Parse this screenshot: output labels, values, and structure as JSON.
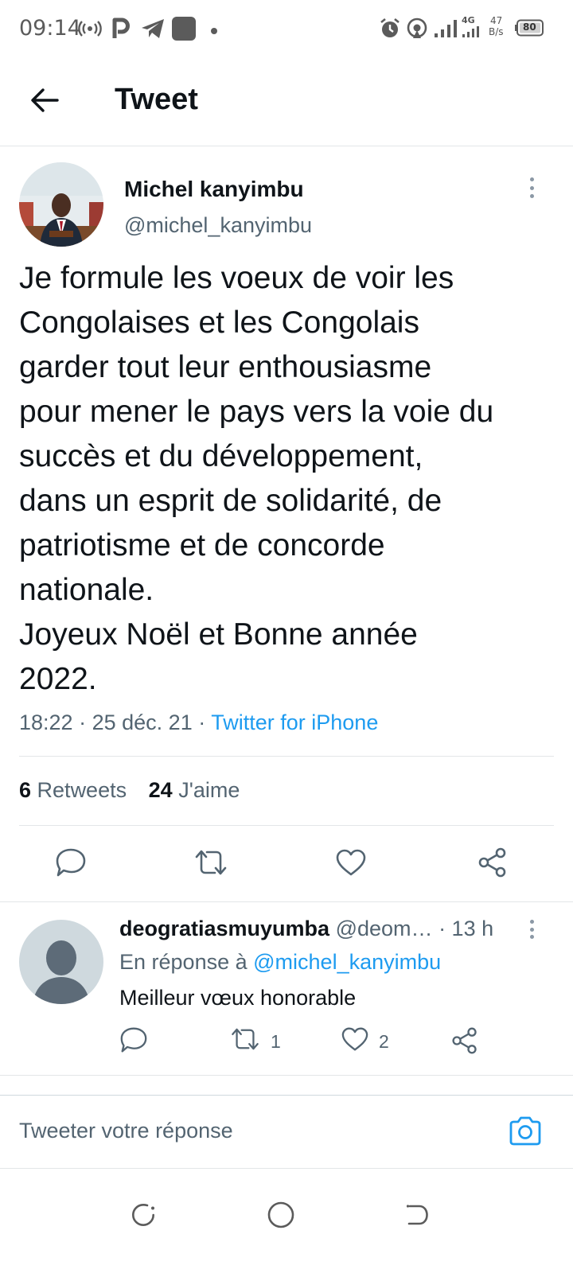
{
  "status_bar": {
    "time": "09:14",
    "network_type": "4G",
    "speed_value": "47",
    "speed_unit": "B/s",
    "battery": "80"
  },
  "header": {
    "title": "Tweet"
  },
  "tweet": {
    "author_name": "Michel kanyimbu",
    "author_handle": "@michel_kanyimbu",
    "text": "Je formule les voeux de voir les\nCongolaises et les Congolais\ngarder tout leur enthousiasme\npour mener le pays vers la voie du\nsuccès et du développement,\ndans un esprit de solidarité, de\npatriotisme et de concorde\nnationale.\nJoyeux Noël et Bonne année\n2022.",
    "time": "18:22",
    "date": "25 déc. 21",
    "separator": "·",
    "source": "Twitter for iPhone",
    "retweet_count": "6",
    "retweet_label": "Retweets",
    "like_count": "24",
    "like_label": "J'aime"
  },
  "reply": {
    "author_name": "deogratiasmuyumba",
    "author_handle": "@deom…",
    "time": "· 13 h",
    "context_prefix": "En réponse à",
    "context_mention": "@michel_kanyimbu",
    "text": "Meilleur vœux honorable",
    "retweet_count": "1",
    "like_count": "2"
  },
  "composer": {
    "placeholder": "Tweeter votre réponse"
  },
  "colors": {
    "accent": "#1d9bf0",
    "text_primary": "#0f1419",
    "text_secondary": "#536471",
    "icon": "#536471",
    "divider": "#e3e6e8"
  }
}
